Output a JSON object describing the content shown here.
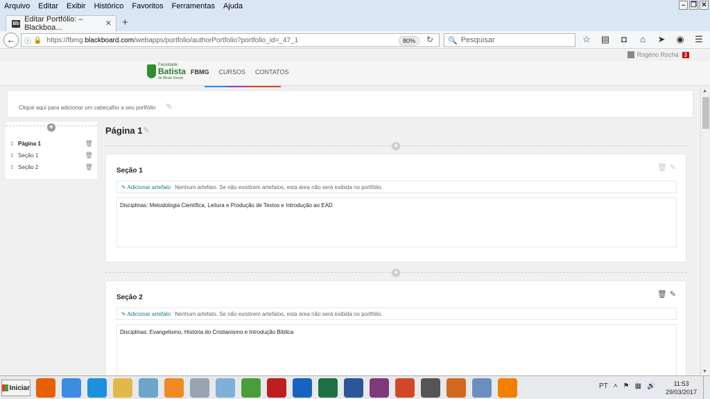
{
  "menu": [
    "Arquivo",
    "Editar",
    "Exibir",
    "Histórico",
    "Favoritos",
    "Ferramentas",
    "Ajuda"
  ],
  "tab": {
    "title": "Editar Portfólio: – Blackboa..."
  },
  "address": {
    "prefix": "https://fbmg.",
    "host": "blackboard.com",
    "path": "/webapps/portfolio/authorPortfolio?portfolio_id=_47_1",
    "zoom": "80%"
  },
  "search": {
    "placeholder": "Pesquisar"
  },
  "user": {
    "name": "Rogério Rocha",
    "notifications": "3"
  },
  "brand": {
    "line1": "Faculdade",
    "line2": "Batista",
    "line3": "de Minas Gerais"
  },
  "bbnav": [
    "FBMG",
    "CURSOS",
    "CONTATOS"
  ],
  "portfolio": {
    "header_prompt": "Clique aqui para adicionar um cabeçalho a seu portfólio",
    "page_title": "Página 1",
    "sidebar": [
      "Página 1",
      "Seção 1",
      "Seção 2"
    ]
  },
  "sections": [
    {
      "title": "Seção 1",
      "add_artifact": "Adicionar artefato",
      "artifact_note": "Nenhum artefato. Se não existirem artefatos, esta área não será exibida no portfólio.",
      "content": "Disciplinas: Metodologia Científica, Leitura e Produção de Textos e Introdução ao EAD"
    },
    {
      "title": "Seção 2",
      "add_artifact": "Adicionar artefato",
      "artifact_note": "Nenhum artefato. Se não existirem artefatos, esta área não será exibida no portfólio.",
      "content": "Disciplinas: Evangelismo, História do Cristianismo e Introdução Bíblica"
    }
  ],
  "taskbar": {
    "start": "Iniciar",
    "language": "PT",
    "time": "11:53",
    "date": "29/03/2017",
    "apps": [
      {
        "name": "firefox-icon",
        "color": "#e66000"
      },
      {
        "name": "chrome-icon",
        "color": "#3b8de0"
      },
      {
        "name": "ie-icon",
        "color": "#1e90e0"
      },
      {
        "name": "file-explorer-icon",
        "color": "#e2b84a"
      },
      {
        "name": "notes-icon",
        "color": "#6ea6c9"
      },
      {
        "name": "media-player-icon",
        "color": "#f08a24"
      },
      {
        "name": "calculator-icon",
        "color": "#9aa4b0"
      },
      {
        "name": "paint-icon",
        "color": "#7fb0d8"
      },
      {
        "name": "spreadsheet-app-icon",
        "color": "#4a9e3a"
      },
      {
        "name": "filezilla-icon",
        "color": "#bf1e1e"
      },
      {
        "name": "outlook-icon",
        "color": "#1565c0"
      },
      {
        "name": "excel-icon",
        "color": "#1e7145"
      },
      {
        "name": "word-icon",
        "color": "#2b579a"
      },
      {
        "name": "onenote-icon",
        "color": "#80397b"
      },
      {
        "name": "powerpoint-icon",
        "color": "#d24726"
      },
      {
        "name": "video-icon",
        "color": "#555555"
      },
      {
        "name": "film-reel-icon",
        "color": "#d2691e"
      },
      {
        "name": "presentation-icon",
        "color": "#6a8fbf"
      },
      {
        "name": "vlc-icon",
        "color": "#f08000"
      }
    ]
  }
}
